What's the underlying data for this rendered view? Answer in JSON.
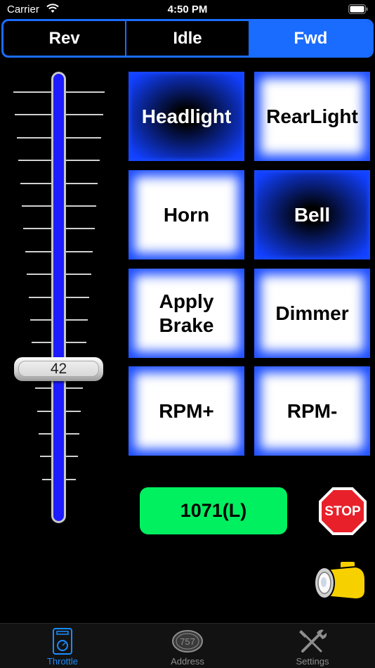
{
  "status_bar": {
    "carrier": "Carrier",
    "time": "4:50 PM"
  },
  "direction": {
    "options": [
      "Rev",
      "Idle",
      "Fwd"
    ],
    "selected": "Fwd"
  },
  "throttle": {
    "value": "42",
    "level": 0.42
  },
  "functions": [
    {
      "label": "Headlight",
      "active": true
    },
    {
      "label": "RearLight",
      "active": false
    },
    {
      "label": "Horn",
      "active": false
    },
    {
      "label": "Bell",
      "active": true
    },
    {
      "label": "Apply Brake",
      "active": false
    },
    {
      "label": "Dimmer",
      "active": false
    },
    {
      "label": "RPM+",
      "active": false
    },
    {
      "label": "RPM-",
      "active": false
    }
  ],
  "loco_address": "1071(L)",
  "stop_label": "STOP",
  "tabs": [
    {
      "label": "Throttle",
      "icon": "throttle-icon",
      "active": true
    },
    {
      "label": "Address",
      "icon": "address-icon",
      "badge": "757",
      "active": false
    },
    {
      "label": "Settings",
      "icon": "settings-icon",
      "active": false
    }
  ],
  "colors": {
    "accent": "#1a6cff",
    "button_glow": "#1a4cff",
    "address_green": "#00f060",
    "stop_red": "#e8202a"
  }
}
